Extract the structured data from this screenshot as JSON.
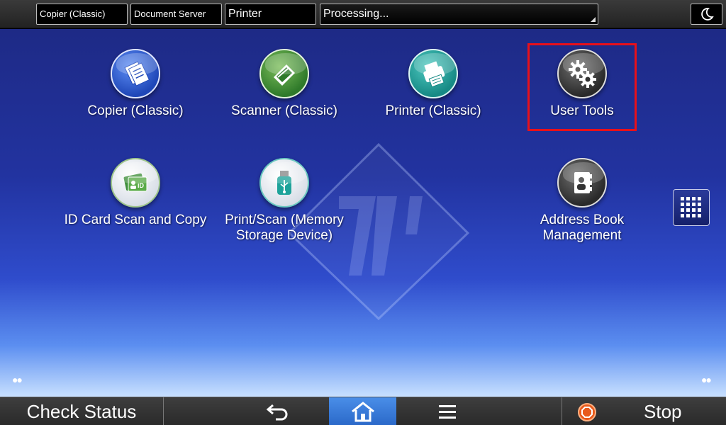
{
  "topbar": {
    "tabs": [
      {
        "label": "Copier (Classic)"
      },
      {
        "label": "Document Server"
      },
      {
        "label": "Printer"
      },
      {
        "label": "Processing..."
      }
    ]
  },
  "apps": [
    {
      "label": "Copier (Classic)",
      "icon": "copier-icon"
    },
    {
      "label": "Scanner (Classic)",
      "icon": "scanner-icon"
    },
    {
      "label": "Printer (Classic)",
      "icon": "printer-icon"
    },
    {
      "label": "User Tools",
      "icon": "gears-icon"
    },
    {
      "label": "ID Card Scan and Copy",
      "icon": "id-card-icon"
    },
    {
      "label": "Print/Scan (Memory Storage Device)",
      "icon": "usb-icon"
    },
    {
      "label": "Address Book Management",
      "icon": "address-book-icon"
    }
  ],
  "bottombar": {
    "check_status": "Check Status",
    "stop": "Stop"
  },
  "colors": {
    "highlight": "#e8101a",
    "home_active": "#3a7ad8",
    "stop_icon": "#e85a1c"
  }
}
